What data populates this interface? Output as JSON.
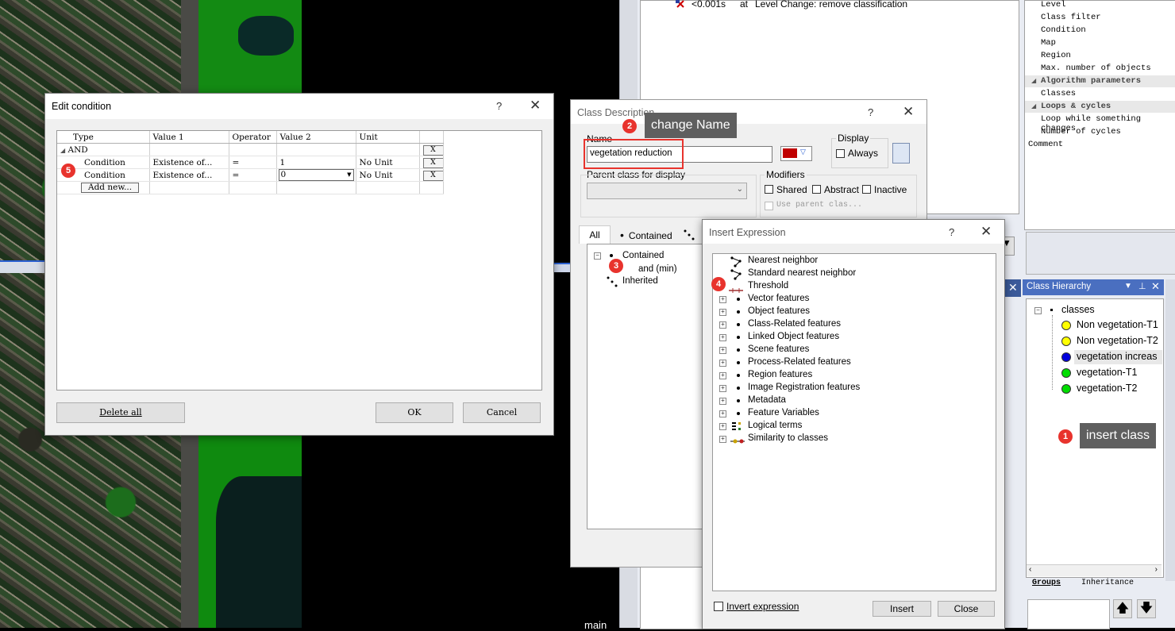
{
  "colors": {
    "accent_red": "#e8332d",
    "class_yellow": "#ffff00",
    "class_blue": "#0000dd",
    "class_green": "#00dd00",
    "class_color_swatch": "#c00000"
  },
  "process_log": {
    "time": "<0.001s",
    "at": "at",
    "text": "Level Change: remove classification"
  },
  "bottom_label": "main",
  "properties": {
    "items": [
      "Level",
      "Class filter",
      "Condition",
      "Map",
      "Region",
      "Max. number of objects"
    ],
    "algo_header": "Algorithm parameters",
    "algo_items": [
      "Classes"
    ],
    "loops_header": "Loops & cycles",
    "loops_items": [
      "Loop while something changes",
      "Number of cycles"
    ],
    "comment": "Comment"
  },
  "class_hierarchy": {
    "title": "Class Hierarchy",
    "root": "classes",
    "items": [
      {
        "label": "Non vegetation-T1",
        "color": "#ffff00"
      },
      {
        "label": "Non vegetation-T2",
        "color": "#ffff00"
      },
      {
        "label": "vegetation increas",
        "color": "#0000dd"
      },
      {
        "label": "vegetation-T1",
        "color": "#00dd00"
      },
      {
        "label": "vegetation-T2",
        "color": "#00dd00"
      }
    ],
    "tab_groups": "Groups",
    "tab_inheritance": "Inheritance"
  },
  "edit_condition": {
    "title": "Edit condition",
    "help": "?",
    "close": "✕",
    "columns": [
      "Type",
      "Value 1",
      "Operator",
      "Value 2",
      "Unit"
    ],
    "root": "AND",
    "rows": [
      {
        "type": "Condition",
        "value1": "Existence of...",
        "operator": "=",
        "value2": "1",
        "unit": "No Unit"
      },
      {
        "type": "Condition",
        "value1": "Existence of...",
        "operator": "=",
        "value2": "0",
        "unit": "No Unit"
      }
    ],
    "remove_label": "X",
    "add_new": "Add new...",
    "delete_all": "Delete all",
    "ok": "OK",
    "cancel": "Cancel"
  },
  "class_description": {
    "title": "Class Description",
    "name_label": "Name",
    "name_value": "vegetation reduction",
    "display_label": "Display",
    "always_label": "Always",
    "parent_label": "Parent class for display",
    "modifiers_label": "Modifiers",
    "shared_label": "Shared",
    "abstract_label": "Abstract",
    "inactive_label": "Inactive",
    "use_parent_label": "Use parent clas...",
    "tab_all": "All",
    "tab_contained": "Contained",
    "tree_contained": "Contained",
    "tree_and": "and (min)",
    "tree_inherited": "Inherited"
  },
  "insert_expression": {
    "title": "Insert Expression",
    "help": "?",
    "close": "✕",
    "items": [
      "Nearest neighbor",
      "Standard nearest neighbor",
      "Threshold",
      "Vector features",
      "Object features",
      "Class-Related features",
      "Linked Object features",
      "Scene features",
      "Process-Related features",
      "Region features",
      "Image Registration features",
      "Metadata",
      "Feature Variables",
      "Logical terms",
      "Similarity to classes"
    ],
    "invert_label": "Invert expression",
    "insert": "Insert",
    "close_button": "Close"
  },
  "annotations": [
    {
      "num": "1",
      "text": "insert class"
    },
    {
      "num": "2",
      "text": "change Name"
    },
    {
      "num": "3",
      "text": ""
    },
    {
      "num": "4",
      "text": ""
    },
    {
      "num": "5",
      "text": ""
    }
  ]
}
